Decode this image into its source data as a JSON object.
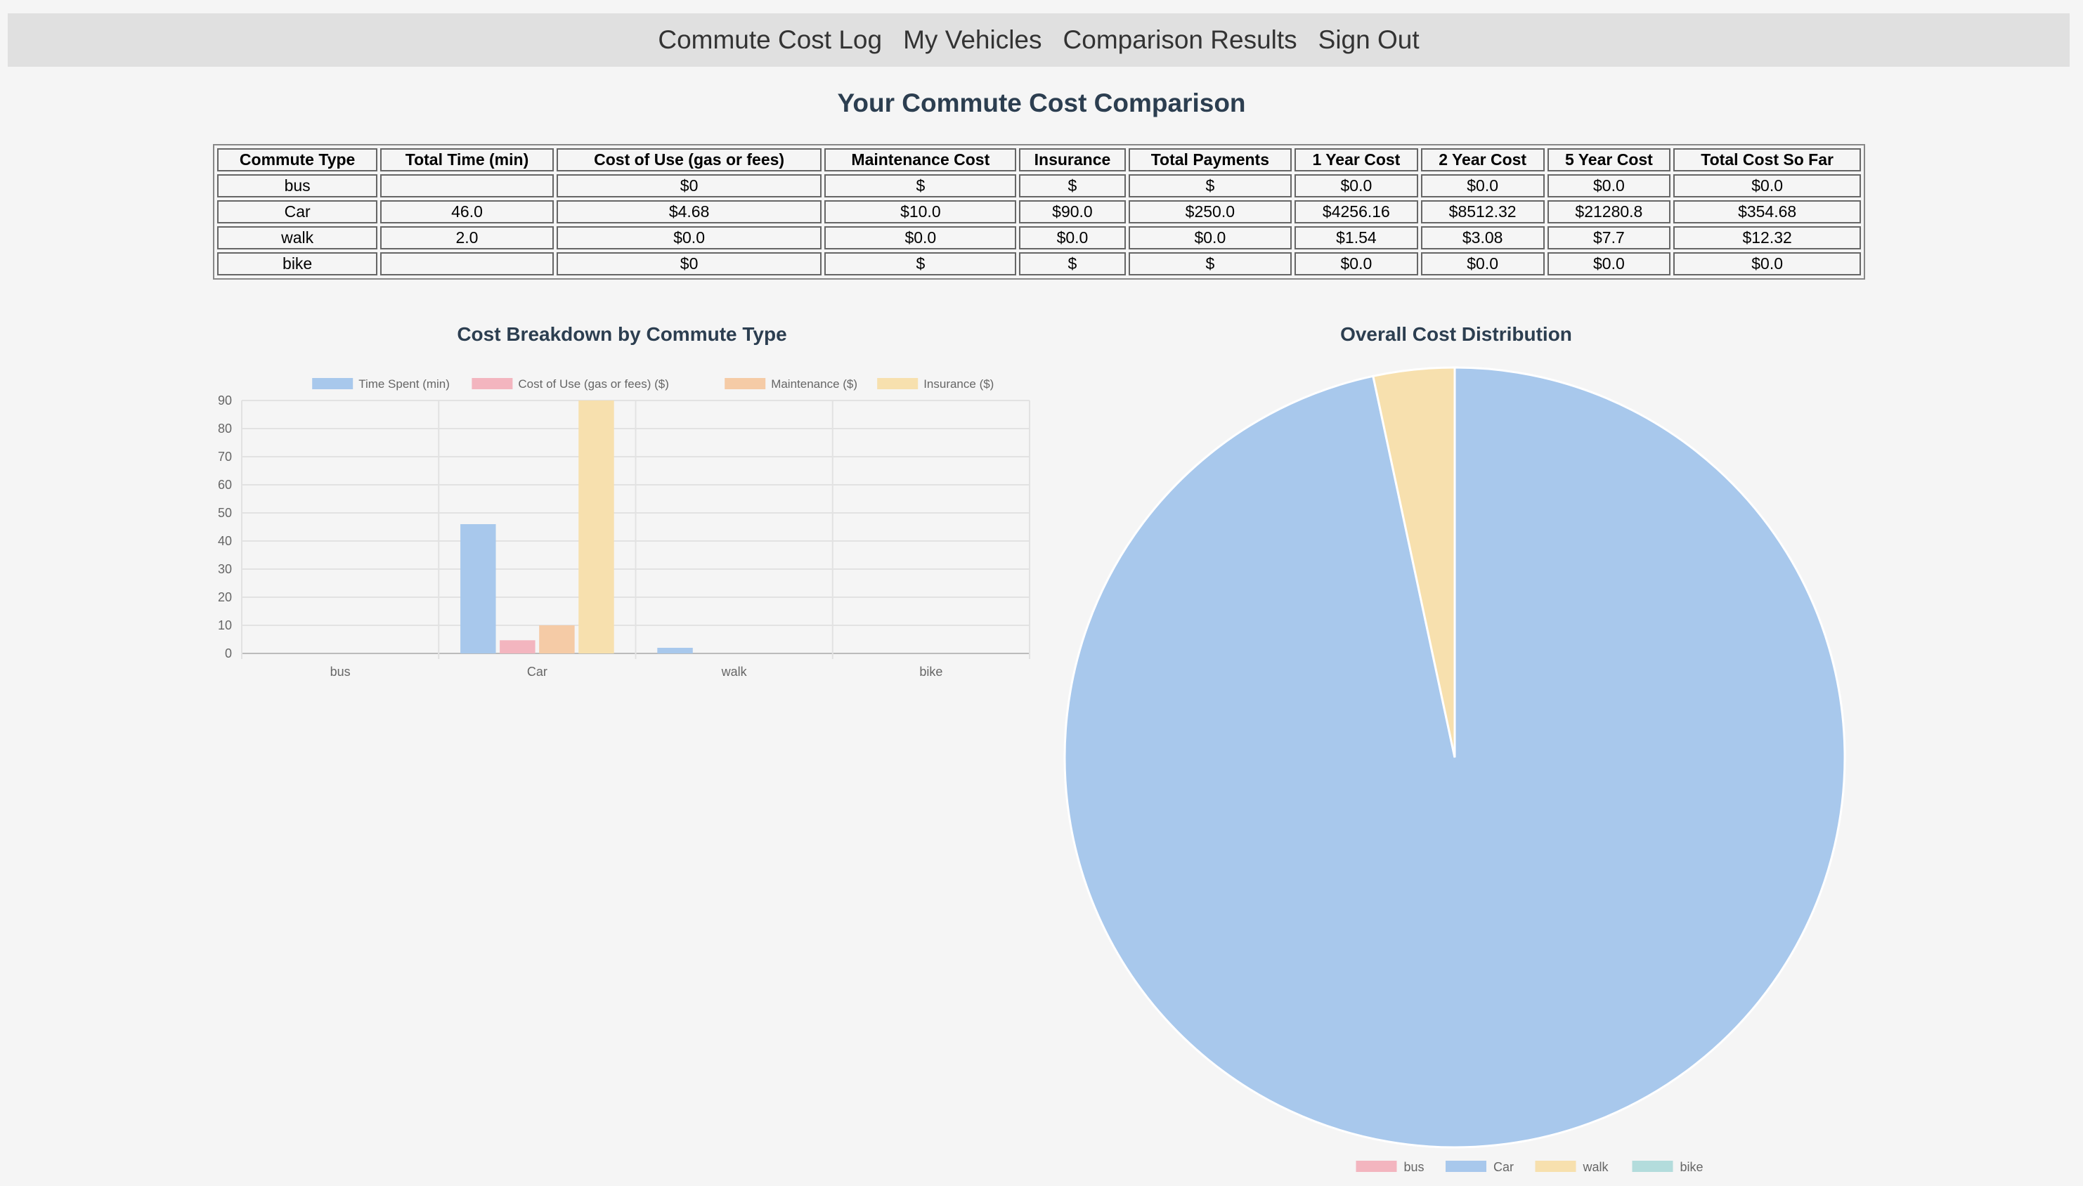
{
  "nav": {
    "items": [
      "Commute Cost Log",
      "My Vehicles",
      "Comparison Results",
      "Sign Out"
    ]
  },
  "page_title": "Your Commute Cost Comparison",
  "table": {
    "headers": [
      "Commute Type",
      "Total Time (min)",
      "Cost of Use (gas or fees)",
      "Maintenance Cost",
      "Insurance",
      "Total Payments",
      "1 Year Cost",
      "2 Year Cost",
      "5 Year Cost",
      "Total Cost So Far"
    ],
    "rows": [
      [
        "bus",
        "",
        "$0",
        "$",
        "$",
        "$",
        "$0.0",
        "$0.0",
        "$0.0",
        "$0.0"
      ],
      [
        "Car",
        "46.0",
        "$4.68",
        "$10.0",
        "$90.0",
        "$250.0",
        "$4256.16",
        "$8512.32",
        "$21280.8",
        "$354.68"
      ],
      [
        "walk",
        "2.0",
        "$0.0",
        "$0.0",
        "$0.0",
        "$0.0",
        "$1.54",
        "$3.08",
        "$7.7",
        "$12.32"
      ],
      [
        "bike",
        "",
        "$0",
        "$",
        "$",
        "$",
        "$0.0",
        "$0.0",
        "$0.0",
        "$0.0"
      ]
    ]
  },
  "chart_data": [
    {
      "type": "bar",
      "title": "Cost Breakdown by Commute Type",
      "categories": [
        "bus",
        "Car",
        "walk",
        "bike"
      ],
      "series": [
        {
          "name": "Time Spent (min)",
          "values": [
            0,
            46,
            2,
            0
          ],
          "color": "#a8c8ec"
        },
        {
          "name": "Cost of Use (gas or fees) ($)",
          "values": [
            0,
            4.68,
            0,
            0
          ],
          "color": "#f3b5bf"
        },
        {
          "name": "Maintenance ($)",
          "values": [
            0,
            10,
            0,
            0
          ],
          "color": "#f5cba6"
        },
        {
          "name": "Insurance ($)",
          "values": [
            0,
            90,
            0,
            0
          ],
          "color": "#f7e0ae"
        }
      ],
      "yticks": [
        0,
        10,
        20,
        30,
        40,
        50,
        60,
        70,
        80,
        90
      ],
      "ylim": [
        0,
        90
      ],
      "grid": true,
      "legend": "top"
    },
    {
      "type": "pie",
      "title": "Overall Cost Distribution",
      "labels": [
        "bus",
        "Car",
        "walk",
        "bike"
      ],
      "values": [
        0,
        354.68,
        12.32,
        0
      ],
      "colors": [
        "#f3b5bf",
        "#a8c8ec",
        "#f7e0ae",
        "#b3dcdc"
      ],
      "legend": "bottom"
    }
  ]
}
